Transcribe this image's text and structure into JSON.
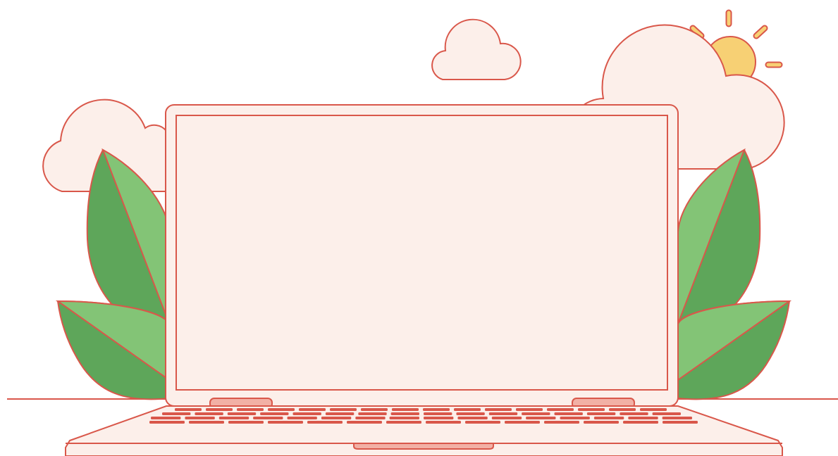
{
  "illustration": {
    "subject": "laptop-with-plants-clouds-sun",
    "screen_text": ""
  },
  "colors": {
    "background": "#ffffff",
    "outline": "#d9574a",
    "fill_light": "#fcefea",
    "leaf_light": "#83c476",
    "leaf_dark": "#5ea65a",
    "sun": "#f7d074",
    "hinge": "#f2b0a5",
    "key": "#d9574a"
  },
  "icons": [
    "cloud-icon",
    "sun-icon",
    "leaf-icon",
    "laptop-icon"
  ]
}
